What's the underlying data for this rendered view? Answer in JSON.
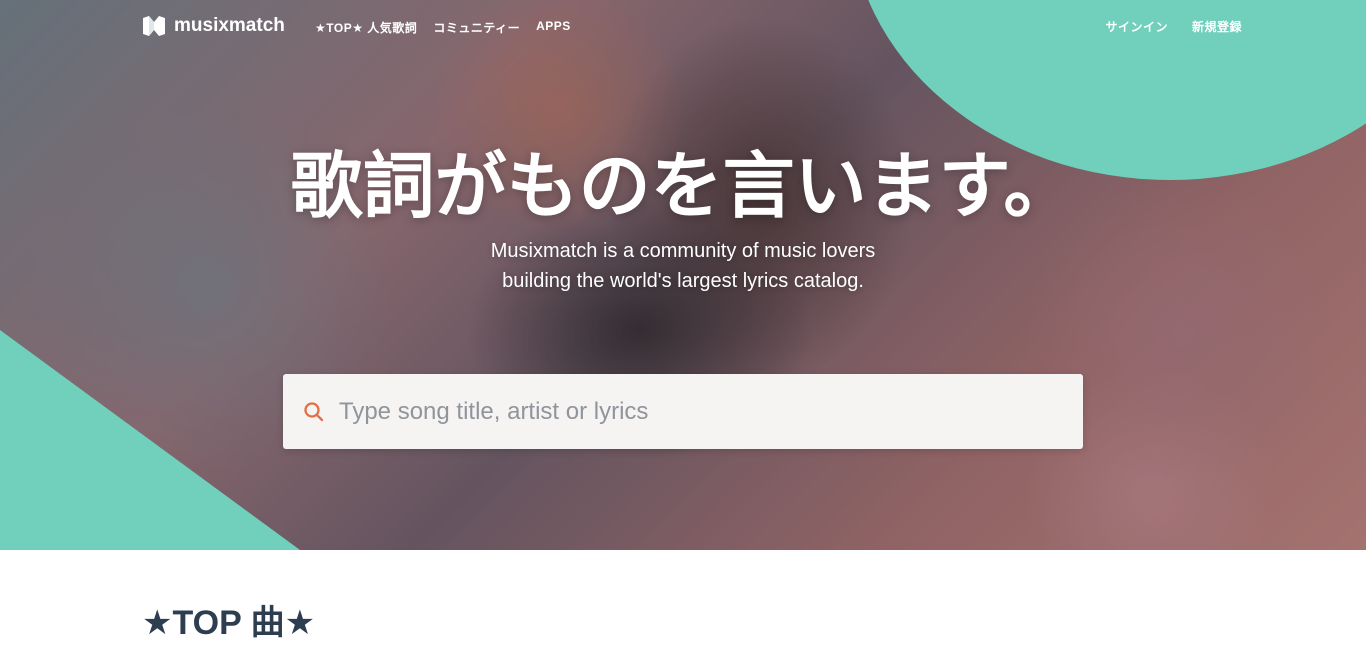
{
  "brand": {
    "name": "musixmatch"
  },
  "nav": {
    "links": [
      "★TOP★ 人気歌詞",
      "コミュニティー",
      "APPS"
    ],
    "sign_in": "サインイン",
    "sign_up": "新規登録"
  },
  "hero": {
    "headline": "歌詞がものを言います。",
    "subheadline_line_1": "Musixmatch is a community of music lovers",
    "subheadline_line_2": "building the world's largest lyrics catalog."
  },
  "search": {
    "placeholder": "Type song title, artist or lyrics"
  },
  "section": {
    "title": "★TOP 曲★"
  },
  "colors": {
    "accent": "#71d0bc",
    "search_icon": "#e26f45",
    "section_title": "#2d3e50"
  },
  "icons": {
    "brand": "musixmatch-logo-icon",
    "search": "search-icon"
  }
}
